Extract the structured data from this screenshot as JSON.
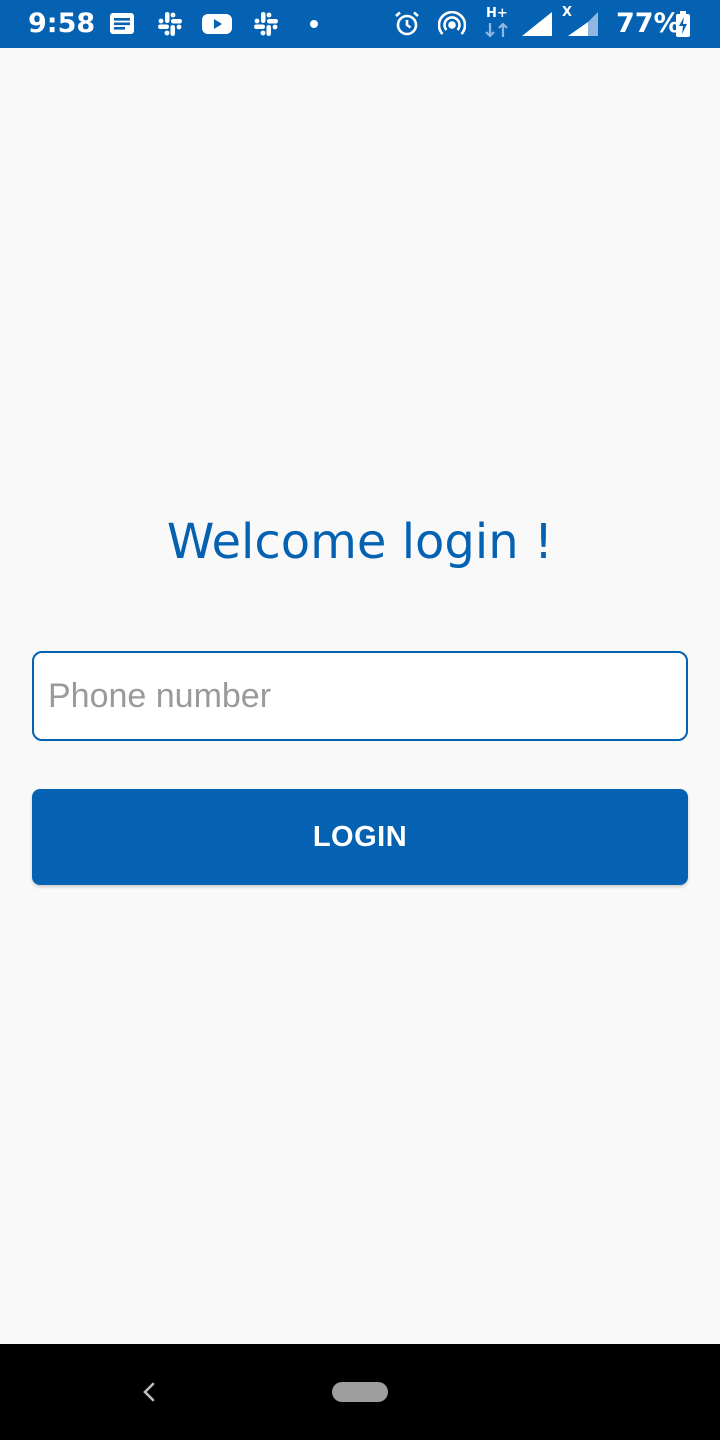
{
  "status_bar": {
    "time": "9:58",
    "battery": "77%",
    "network_type": "H+",
    "no_signal_mark": "X",
    "background_color": "#0562b3",
    "icons": [
      "message-icon",
      "slack-icon",
      "youtube-icon",
      "slack-icon",
      "dot-icon",
      "alarm-icon",
      "hotspot-icon",
      "signal-icon",
      "signal-icon",
      "battery-charging-icon"
    ]
  },
  "login": {
    "title": "Welcome login !",
    "phone_placeholder": "Phone number",
    "phone_value": "",
    "button_label": "LOGIN",
    "accent_color": "#0562b3"
  },
  "nav_bar": {
    "icons": [
      "back-icon",
      "home-pill-icon"
    ]
  }
}
